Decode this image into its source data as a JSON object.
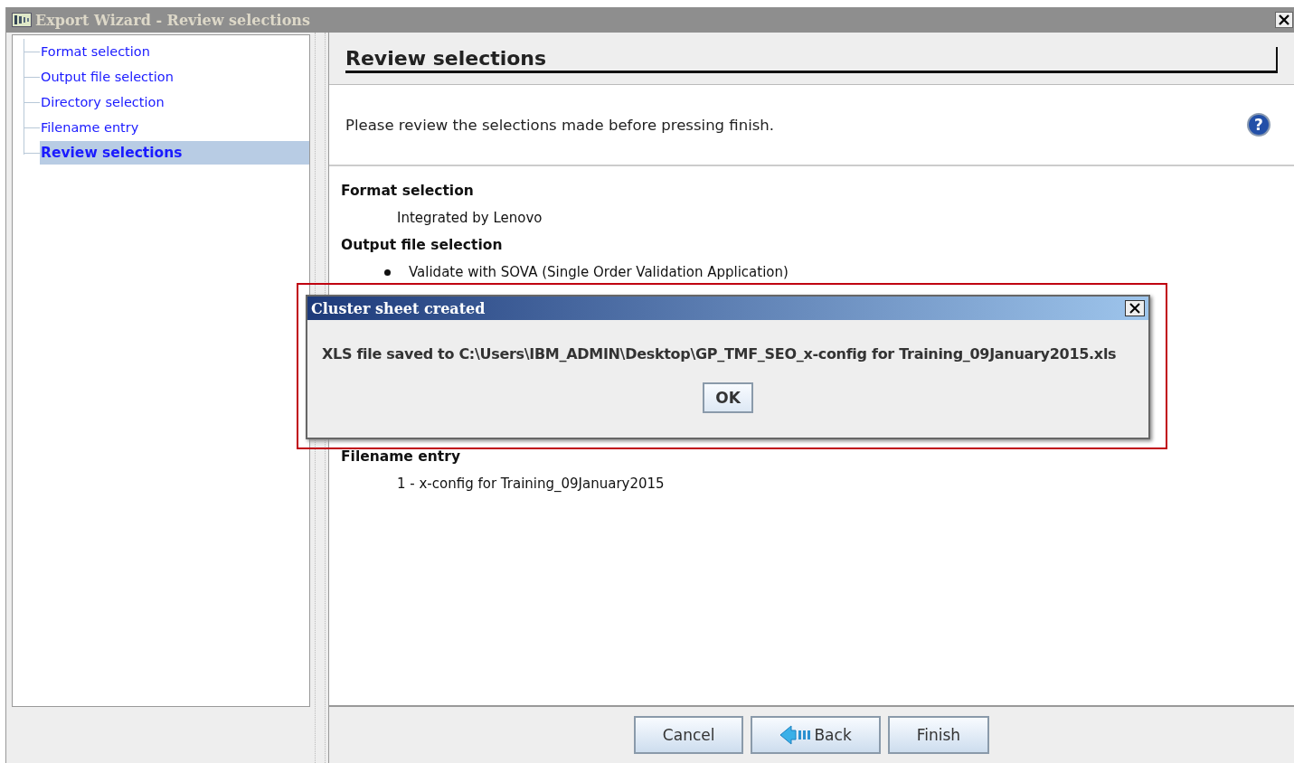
{
  "window": {
    "title": "Export Wizard - Review selections"
  },
  "steps": [
    {
      "label": "Format selection",
      "selected": false
    },
    {
      "label": "Output file selection",
      "selected": false
    },
    {
      "label": "Directory selection",
      "selected": false
    },
    {
      "label": "Filename entry",
      "selected": false
    },
    {
      "label": "Review selections",
      "selected": true
    }
  ],
  "header": {
    "title": "Review selections",
    "description": "Please review the selections made before pressing finish.",
    "help": "?"
  },
  "sections": [
    {
      "heading": "Format selection",
      "items": [
        {
          "kind": "plain",
          "text": "Integrated by Lenovo"
        }
      ]
    },
    {
      "heading": "Output file selection",
      "items": [
        {
          "kind": "bullet",
          "text": "Validate with SOVA (Single Order Validation Application)"
        }
      ]
    },
    {
      "heading": "Filename entry",
      "items": [
        {
          "kind": "plain",
          "text": "1 - x-config for Training_09January2015"
        }
      ]
    }
  ],
  "buttons": [
    {
      "label": "Cancel",
      "kind": "plain"
    },
    {
      "label": "Back",
      "kind": "back"
    },
    {
      "label": "Finish",
      "kind": "plain"
    }
  ],
  "dialog": {
    "title": "Cluster sheet created",
    "message": "XLS file saved to C:\\Users\\IBM_ADMIN\\Desktop\\GP_TMF_SEO_x-config for Training_09January2015.xls",
    "button": "OK"
  }
}
